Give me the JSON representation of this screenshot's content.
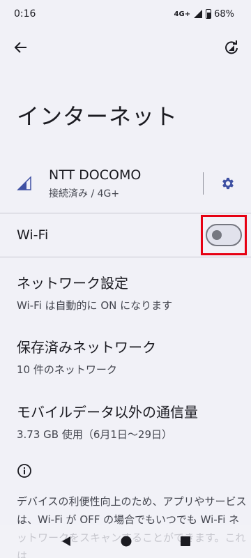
{
  "status": {
    "time": "0:16",
    "network": "4G+",
    "battery": "68%"
  },
  "appbar": {
    "back_icon": "arrow-back-icon",
    "reset_icon": "reset-network-icon"
  },
  "page": {
    "title": "インターネット"
  },
  "carrier": {
    "name": "NTT DOCOMO",
    "status": "接続済み / 4G+",
    "signal_icon": "signal-icon",
    "settings_icon": "gear-icon"
  },
  "wifi": {
    "label": "Wi-Fi",
    "enabled": false
  },
  "items": [
    {
      "title": "ネットワーク設定",
      "subtitle": "Wi-Fi は自動的に ON になります"
    },
    {
      "title": "保存済みネットワーク",
      "subtitle": "10 件のネットワーク"
    },
    {
      "title": "モバイルデータ以外の通信量",
      "subtitle": "3.73 GB 使用（6月1日〜29日）"
    }
  ],
  "footer": {
    "text": "デバイスの利便性向上のため、アプリやサービスは、Wi-Fi が OFF の場合でもいつでも Wi-Fi ネットワークをスキャンすることができます。これは"
  },
  "colors": {
    "background": "#f1f1f7",
    "accent": "#3f51a3",
    "highlight": "#e60012"
  }
}
